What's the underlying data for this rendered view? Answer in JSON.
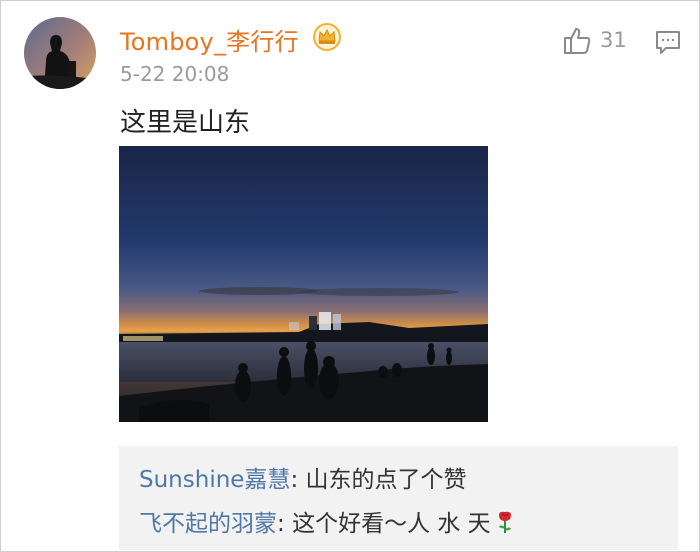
{
  "post": {
    "username": "Tomboy_李行行",
    "timestamp": "5-22 20:08",
    "text": "这里是山东",
    "likes": "31"
  },
  "icons": {
    "badge": "crown-badge-icon",
    "like": "thumbs-up-icon",
    "comment": "comment-icon",
    "emoji": "rose-emoji-icon"
  },
  "colors": {
    "username": "#e8741f",
    "comment_user": "#4f77a8",
    "meta": "#9a9a9a",
    "comment_bg": "#f2f2f2"
  },
  "comments": [
    {
      "user": "Sunshine嘉慧",
      "sep": ": ",
      "text": "山东的点了个赞"
    },
    {
      "user": "飞不起的羽蒙",
      "sep": ": ",
      "text": "这个好看～人 水 天"
    }
  ]
}
